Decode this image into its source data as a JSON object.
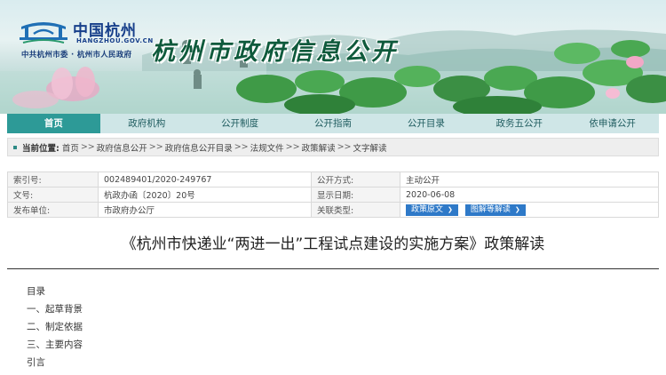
{
  "header": {
    "logo_cn": "中国杭州",
    "logo_domain": "HANGZHOU.GOV.CN",
    "logo_sub": "中共杭州市委 · 杭州市人民政府",
    "site_title": "杭州市政府信息公开"
  },
  "nav": {
    "items": [
      {
        "label": "首页"
      },
      {
        "label": "政府机构"
      },
      {
        "label": "公开制度"
      },
      {
        "label": "公开指南"
      },
      {
        "label": "公开目录"
      },
      {
        "label": "政务五公开"
      },
      {
        "label": "依申请公开"
      }
    ]
  },
  "breadcrumb": {
    "label": "当前位置:",
    "items": [
      "首页",
      "政府信息公开",
      "政府信息公开目录",
      "法规文件",
      "政策解读",
      "文字解读"
    ],
    "separator": ">>"
  },
  "info": {
    "index_label": "索引号:",
    "index_value": "002489401/2020-249767",
    "mode_label": "公开方式:",
    "mode_value": "主动公开",
    "docno_label": "文号:",
    "docno_value": "杭政办函〔2020〕20号",
    "date_label": "显示日期:",
    "date_value": "2020-06-08",
    "issuer_label": "发布单位:",
    "issuer_value": "市政府办公厅",
    "related_label": "关联类型:",
    "related_buttons": [
      "政策原文",
      "图解等解读"
    ]
  },
  "document": {
    "title": "《杭州市快递业“两进一出”工程试点建设的实施方案》政策解读"
  },
  "toc": {
    "items": [
      "目录",
      "一、起草背景",
      "二、制定依据",
      "三、主要内容",
      "引言"
    ]
  },
  "colors": {
    "nav_bg": "#cfe6e7",
    "nav_active": "#2d9a97",
    "button_blue": "#2e79c8",
    "title_green": "#0f5a3c"
  }
}
